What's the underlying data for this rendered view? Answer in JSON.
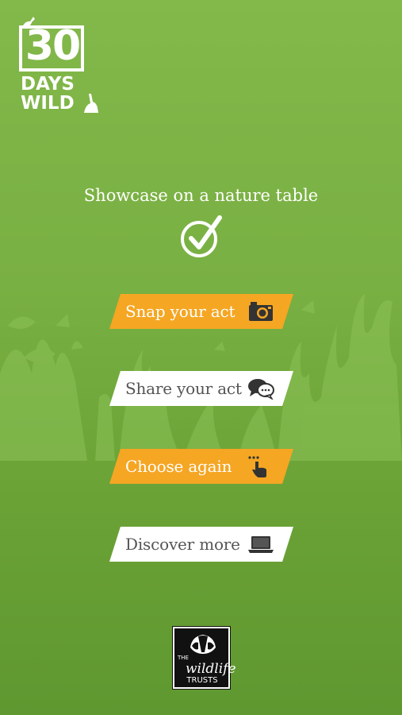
{
  "logo": {
    "number": "30",
    "line1": "DAYS",
    "line2": "WILD"
  },
  "headline": "Showcase on a nature table",
  "buttons": [
    {
      "label": "Snap your act",
      "icon": "camera-icon",
      "style": "orange"
    },
    {
      "label": "Share your act",
      "icon": "speech-bubbles-icon",
      "style": "white"
    },
    {
      "label": "Choose again",
      "icon": "pointing-hand-icon",
      "style": "orange"
    },
    {
      "label": "Discover more",
      "icon": "laptop-icon",
      "style": "white"
    }
  ],
  "footer_logo": {
    "the": "THE",
    "wildlife": "wildlife",
    "trusts": "TRUSTS"
  },
  "colors": {
    "accent_orange": "#f5a623",
    "background_green": "#79b043",
    "button_white": "#ffffff"
  }
}
